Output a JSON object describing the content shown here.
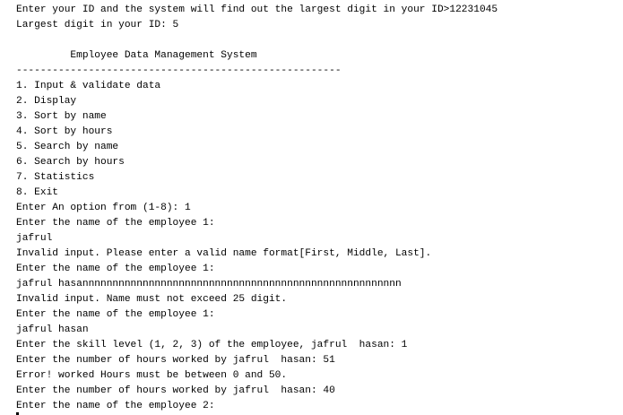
{
  "console": {
    "lines": [
      "Enter your ID and the system will find out the largest digit in your ID>12231045",
      "Largest digit in your ID: 5",
      "",
      "         Employee Data Management System",
      "------------------------------------------------------",
      "1. Input & validate data",
      "2. Display",
      "3. Sort by name",
      "4. Sort by hours",
      "5. Search by name",
      "6. Search by hours",
      "7. Statistics",
      "8. Exit",
      "Enter An option from (1-8): 1",
      "Enter the name of the employee 1:",
      "jafrul",
      "Invalid input. Please enter a valid name format[First, Middle, Last].",
      "Enter the name of the employee 1:",
      "jafrul hasannnnnnnnnnnnnnnnnnnnnnnnnnnnnnnnnnnnnnnnnnnnnnnnnnnnn",
      "Invalid input. Name must not exceed 25 digit.",
      "Enter the name of the employee 1:",
      "jafrul hasan",
      "Enter the skill level (1, 2, 3) of the employee, jafrul  hasan: 1",
      "Enter the number of hours worked by jafrul  hasan: 51",
      "Error! worked Hours must be between 0 and 50.",
      "Enter the number of hours worked by jafrul  hasan: 40",
      "Enter the name of the employee 2:"
    ]
  }
}
